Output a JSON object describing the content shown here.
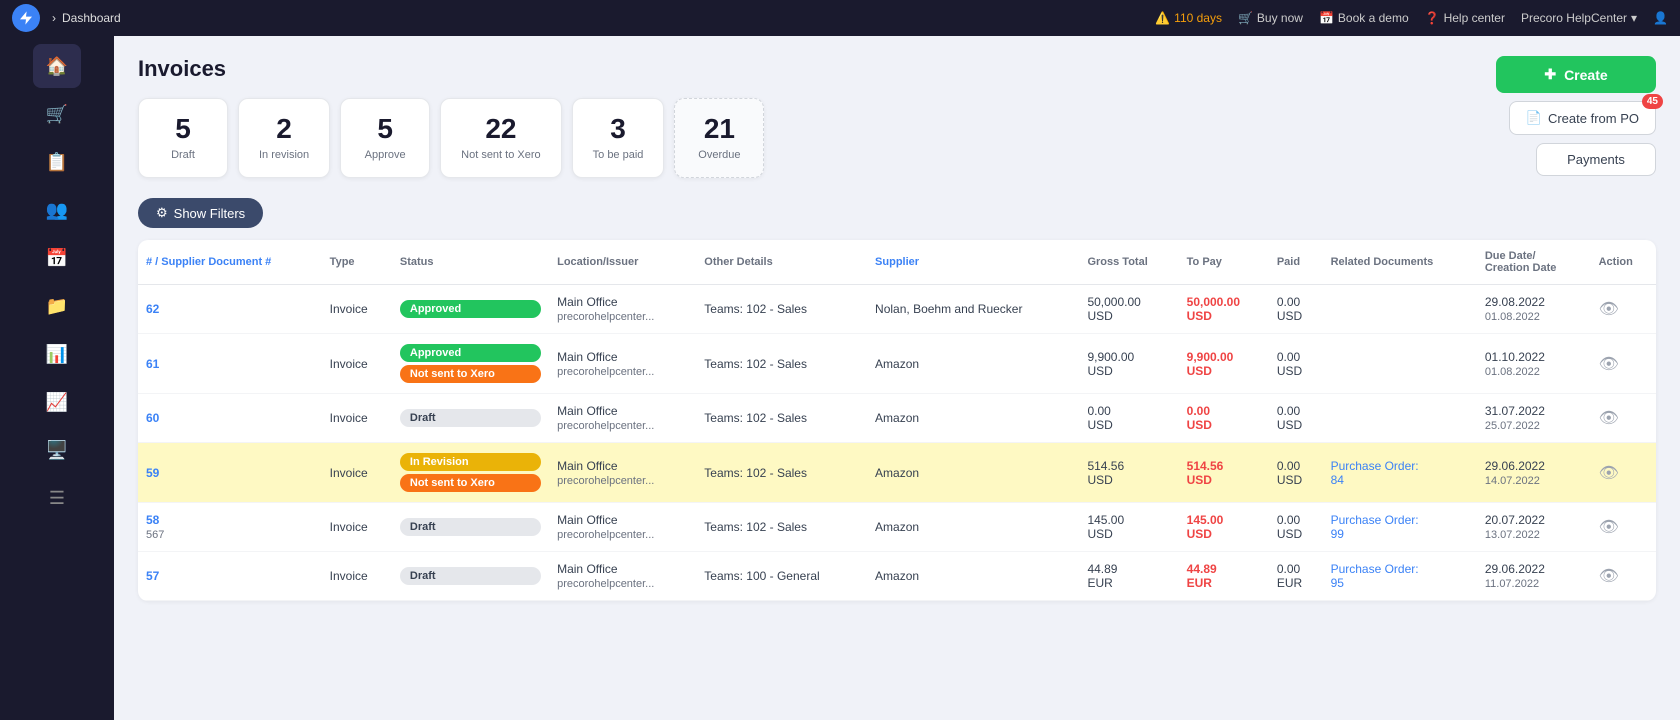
{
  "topnav": {
    "breadcrumb_arrow": "›",
    "breadcrumb_item": "Dashboard",
    "warning": "110 days",
    "buy_now": "Buy now",
    "book_demo": "Book a demo",
    "help_center": "Help center",
    "helpcenter_user": "Precoro HelpCenter"
  },
  "page": {
    "title": "Invoices"
  },
  "stats": [
    {
      "number": "5",
      "label": "Draft"
    },
    {
      "number": "2",
      "label": "In revision"
    },
    {
      "number": "5",
      "label": "Approve"
    },
    {
      "number": "22",
      "label": "Not sent to Xero"
    },
    {
      "number": "3",
      "label": "To be paid"
    },
    {
      "number": "21",
      "label": "Overdue"
    }
  ],
  "actions": {
    "create_label": "Create",
    "create_po_label": "Create from PO",
    "payments_label": "Payments",
    "badge": "45"
  },
  "toolbar": {
    "filter_label": "Show Filters"
  },
  "table": {
    "columns": [
      "# / Supplier Document #",
      "Type",
      "Status",
      "Location/Issuer",
      "Other Details",
      "Supplier",
      "Gross Total",
      "To Pay",
      "Paid",
      "Related Documents",
      "Due Date/ Creation Date",
      "Action"
    ],
    "rows": [
      {
        "id": "62",
        "id_sub": "",
        "type": "Invoice",
        "statuses": [
          "Approved"
        ],
        "location": "Main Office",
        "location_sub": "precorohelpcenter...",
        "details": "Teams: 102 - Sales",
        "supplier": "Nolan, Boehm and Ruecker",
        "gross_total": "50,000.00",
        "gross_currency": "USD",
        "to_pay": "50,000.00",
        "to_pay_currency": "USD",
        "paid": "0.00",
        "paid_currency": "USD",
        "related": "",
        "due_date": "29.08.2022",
        "creation_date": "01.08.2022",
        "highlighted": false
      },
      {
        "id": "61",
        "id_sub": "",
        "type": "Invoice",
        "statuses": [
          "Approved",
          "Not sent to Xero"
        ],
        "location": "Main Office",
        "location_sub": "precorohelpcenter...",
        "details": "Teams: 102 - Sales",
        "supplier": "Amazon",
        "gross_total": "9,900.00",
        "gross_currency": "USD",
        "to_pay": "9,900.00",
        "to_pay_currency": "USD",
        "paid": "0.00",
        "paid_currency": "USD",
        "related": "",
        "due_date": "01.10.2022",
        "creation_date": "01.08.2022",
        "highlighted": false
      },
      {
        "id": "60",
        "id_sub": "",
        "type": "Invoice",
        "statuses": [
          "Draft"
        ],
        "location": "Main Office",
        "location_sub": "precorohelpcenter...",
        "details": "Teams: 102 - Sales",
        "supplier": "Amazon",
        "gross_total": "0.00",
        "gross_currency": "USD",
        "to_pay": "0.00",
        "to_pay_currency": "USD",
        "paid": "0.00",
        "paid_currency": "USD",
        "related": "",
        "due_date": "31.07.2022",
        "creation_date": "25.07.2022",
        "highlighted": false
      },
      {
        "id": "59",
        "id_sub": "",
        "type": "Invoice",
        "statuses": [
          "In Revision",
          "Not sent to Xero"
        ],
        "location": "Main Office",
        "location_sub": "precorohelpcenter...",
        "details": "Teams: 102 - Sales",
        "supplier": "Amazon",
        "gross_total": "514.56",
        "gross_currency": "USD",
        "to_pay": "514.56",
        "to_pay_currency": "USD",
        "paid": "0.00",
        "paid_currency": "USD",
        "related": "Purchase Order: 84",
        "due_date": "29.06.2022",
        "creation_date": "14.07.2022",
        "highlighted": true
      },
      {
        "id": "58",
        "id_sub": "567",
        "type": "Invoice",
        "statuses": [
          "Draft"
        ],
        "location": "Main Office",
        "location_sub": "precorohelpcenter...",
        "details": "Teams: 102 - Sales",
        "supplier": "Amazon",
        "gross_total": "145.00",
        "gross_currency": "USD",
        "to_pay": "145.00",
        "to_pay_currency": "USD",
        "paid": "0.00",
        "paid_currency": "USD",
        "related": "Purchase Order: 99",
        "due_date": "20.07.2022",
        "creation_date": "13.07.2022",
        "highlighted": false
      },
      {
        "id": "57",
        "id_sub": "",
        "type": "Invoice",
        "statuses": [
          "Draft"
        ],
        "location": "Main Office",
        "location_sub": "precorohelpcenter...",
        "details": "Teams: 100 - General",
        "supplier": "Amazon",
        "gross_total": "44.89",
        "gross_currency": "EUR",
        "to_pay": "44.89",
        "to_pay_currency": "EUR",
        "paid": "0.00",
        "paid_currency": "EUR",
        "related": "Purchase Order: 95",
        "due_date": "29.06.2022",
        "creation_date": "11.07.2022",
        "highlighted": false
      }
    ]
  },
  "sidebar": {
    "items": [
      {
        "icon": "🏠",
        "name": "home"
      },
      {
        "icon": "🛒",
        "name": "orders"
      },
      {
        "icon": "📋",
        "name": "invoices"
      },
      {
        "icon": "👥",
        "name": "users"
      },
      {
        "icon": "📅",
        "name": "calendar"
      },
      {
        "icon": "📁",
        "name": "documents"
      },
      {
        "icon": "📊",
        "name": "reports"
      },
      {
        "icon": "📈",
        "name": "analytics"
      },
      {
        "icon": "🖥️",
        "name": "monitor"
      },
      {
        "icon": "☰",
        "name": "menu"
      }
    ]
  }
}
